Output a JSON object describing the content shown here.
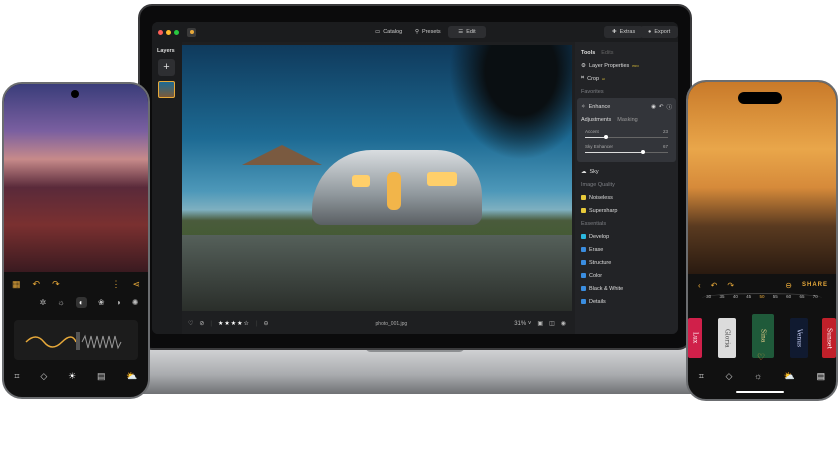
{
  "laptop": {
    "topbar": {
      "catalog": "Catalog",
      "presets": "Presets",
      "edit": "Edit",
      "extras": "Extras",
      "export": "Export"
    },
    "layers": {
      "title": "Layers",
      "add": "+"
    },
    "panel": {
      "tabs": [
        "Tools",
        "Edits"
      ],
      "items_top": [
        {
          "label": "Layer Properties",
          "badge": "PRO"
        },
        {
          "label": "Crop",
          "badge": "AI"
        }
      ],
      "favorites": "Favorites",
      "enhance": {
        "label": "Enhance",
        "tabs": [
          "Adjustments",
          "Masking"
        ],
        "sliders": [
          {
            "label": "Accent",
            "value": 23
          },
          {
            "label": "Sky Enhancer",
            "value": 67
          }
        ]
      },
      "sky": "Sky",
      "image_quality": "Image Quality",
      "quality_items": [
        "Noiseless",
        "Supersharp"
      ],
      "essentials": "Essentials",
      "essential_items": [
        {
          "label": "Develop",
          "color": "#2bb8e0"
        },
        {
          "label": "Erase",
          "color": "#3a8de0"
        },
        {
          "label": "Structure",
          "color": "#3a8de0"
        },
        {
          "label": "Color",
          "color": "#3a8de0"
        },
        {
          "label": "Black & White",
          "color": "#3a8de0"
        },
        {
          "label": "Details",
          "color": "#3a8de0"
        }
      ]
    },
    "bottombar": {
      "filename": "photo_001.jpg",
      "zoom": "31%",
      "rating": 4,
      "max_rating": 5
    }
  },
  "right_phone": {
    "share": "SHARE",
    "dial": [
      "30",
      "35",
      "40",
      "45",
      "50",
      "55",
      "60",
      "65",
      "70"
    ],
    "films": [
      "Lux",
      "Gloria",
      "Sina",
      "Venus",
      "Sunset"
    ]
  },
  "colors": {
    "accent": "#e7a93a",
    "panel": "#222326"
  }
}
